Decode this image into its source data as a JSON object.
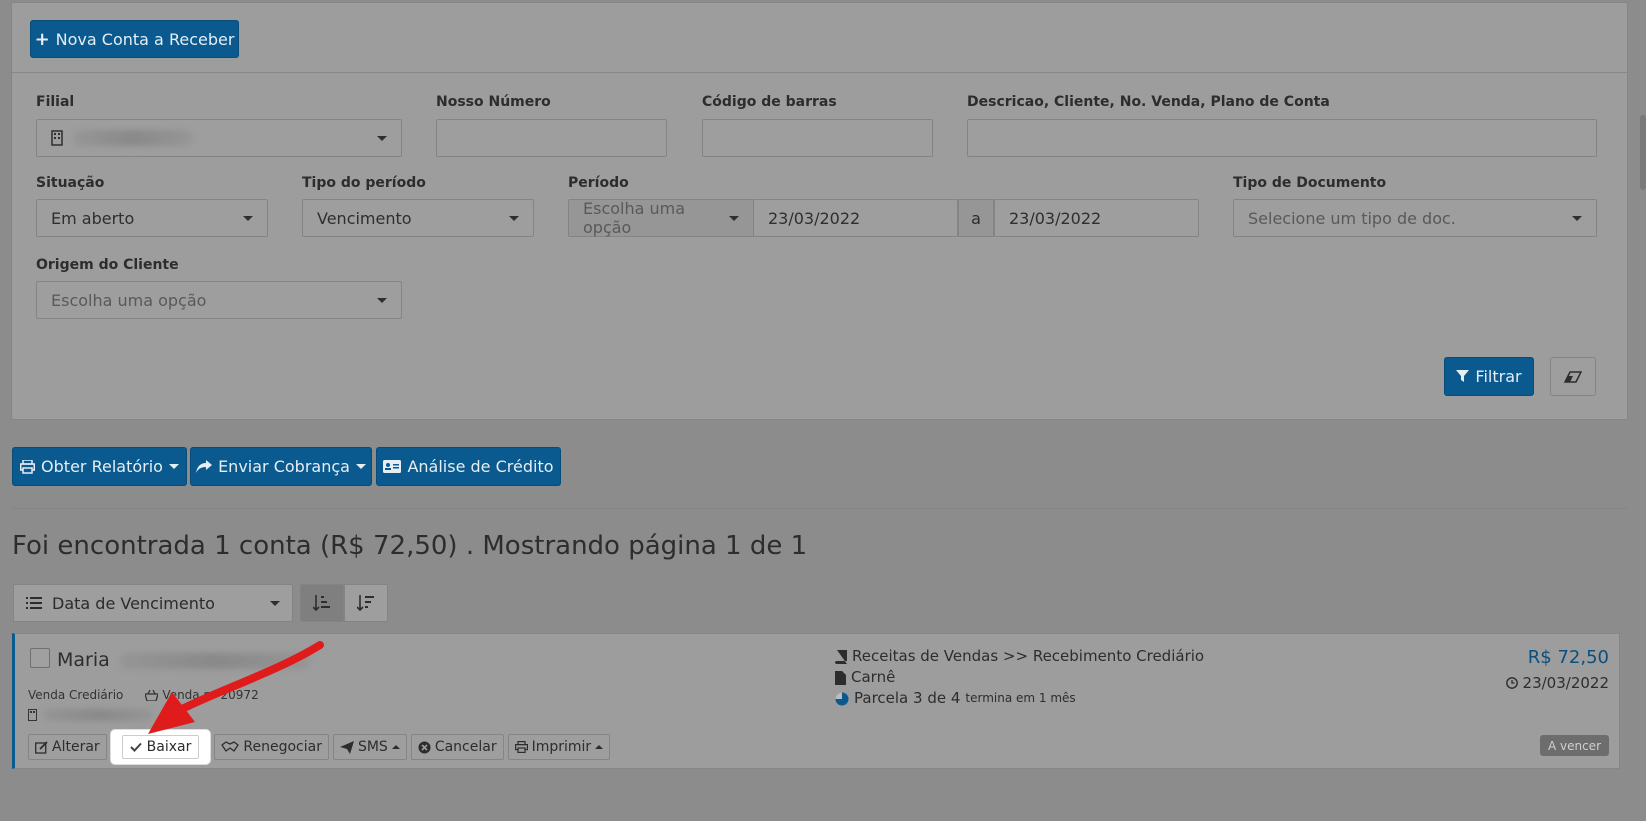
{
  "header": {
    "new_button": "Nova Conta a Receber"
  },
  "filters": {
    "filial_label": "Filial",
    "nosso_numero_label": "Nosso Número",
    "codigo_barras_label": "Código de barras",
    "descricao_label": "Descricao, Cliente, No. Venda, Plano de Conta",
    "situacao_label": "Situação",
    "situacao_value": "Em aberto",
    "tipo_periodo_label": "Tipo do período",
    "tipo_periodo_value": "Vencimento",
    "periodo_label": "Período",
    "periodo_option_placeholder": "Escolha uma opção",
    "periodo_start": "23/03/2022",
    "periodo_separator": "a",
    "periodo_end": "23/03/2022",
    "tipo_documento_label": "Tipo de Documento",
    "tipo_documento_placeholder": "Selecione um tipo de doc.",
    "origem_label": "Origem do Cliente",
    "origem_placeholder": "Escolha uma opção",
    "filter_button": "Filtrar"
  },
  "actions": {
    "report": "Obter Relatório",
    "send_charge": "Enviar Cobrança",
    "credit_analysis": "Análise de Crédito"
  },
  "results": {
    "summary": "Foi encontrada 1 conta (R$ 72,50) . Mostrando página 1 de 1",
    "sort_by": "Data de Vencimento"
  },
  "card": {
    "client_name": "Maria",
    "sale_type": "Venda Crediário",
    "sale_number": "Venda nº 20972",
    "category": "Receitas de Vendas >> Recebimento Crediário",
    "document": "Carnê",
    "installment": "Parcela 3 de 4",
    "installment_note": "termina em 1 mês",
    "amount": "R$ 72,50",
    "due_date": "23/03/2022",
    "status": "A vencer",
    "buttons": {
      "alterar": "Alterar",
      "baixar": "Baixar",
      "renegociar": "Renegociar",
      "sms": "SMS",
      "cancelar": "Cancelar",
      "imprimir": "Imprimir"
    }
  }
}
